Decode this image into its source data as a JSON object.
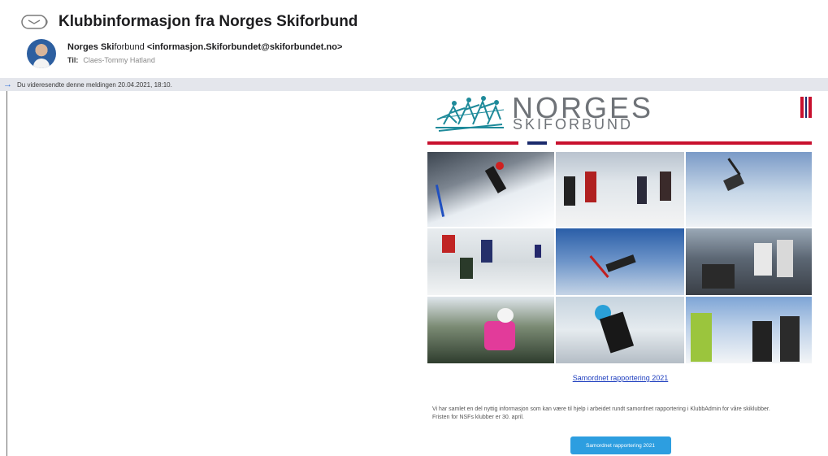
{
  "email": {
    "subject": "Klubbinformasjon fra Norges Skiforbund",
    "sender_name_bold": "Norges Ski",
    "sender_name_rest": "forbund",
    "sender_email": "<informasjon.Skiforbundet@skiforbundet.no>",
    "to_label": "Til:",
    "to_value": "Claes-Tommy Hatland",
    "forwarded_notice": "Du videresendte denne meldingen 20.04.2021, 18:10."
  },
  "newsletter": {
    "logo_line1": "NORGES",
    "logo_line2": "SKIFORBUND",
    "link_text": "Samordnet rapportering 2021",
    "body": "Vi har samlet en del nyttig informasjon som kan være til hjelp i arbeidet rundt samordnet rapportering i KlubbAdmin for våre skiklubber. Fristen for NSFs klubber er 30. april.",
    "cta_label": "Samordnet rapportering 2021"
  },
  "colors": {
    "brand_red": "#c8102e",
    "brand_blue": "#1a2a6c",
    "logo_teal": "#1e8a9a",
    "link": "#1f3fbf",
    "cta": "#2d9ee0",
    "info_bar": "#e4e6ec"
  },
  "icons": {
    "subject": "mail-message-icon",
    "forwarded": "arrow-right-icon"
  }
}
